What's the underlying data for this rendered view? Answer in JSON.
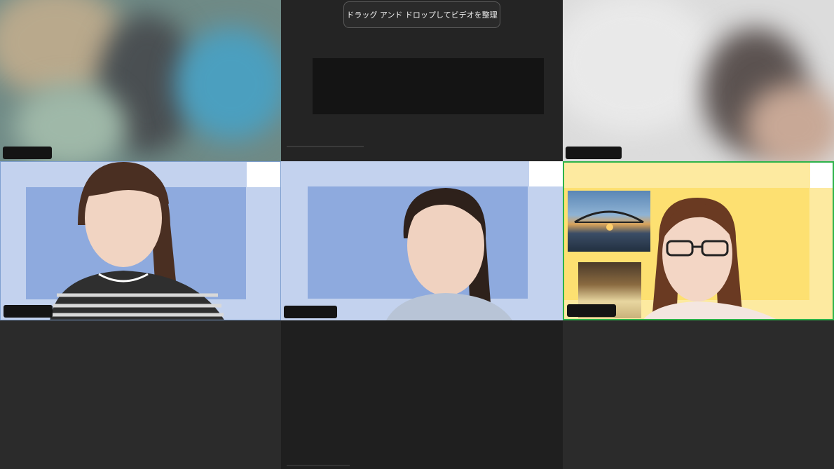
{
  "banner": {
    "text": "ドラッグ アンド ドロップしてビデオを整理"
  },
  "tiles": [
    {
      "id": "tile-1",
      "kind": "blurred-video"
    },
    {
      "id": "tile-2",
      "kind": "screen-share"
    },
    {
      "id": "tile-3",
      "kind": "blurred-video"
    },
    {
      "id": "tile-4",
      "kind": "participant-video",
      "background": "#c3d2ee"
    },
    {
      "id": "tile-5",
      "kind": "participant-video",
      "background": "#c3d2ee"
    },
    {
      "id": "tile-6",
      "kind": "participant-video",
      "background": "#fdeaa0",
      "active_speaker": true,
      "highlight_color": "#2db34a"
    },
    {
      "id": "tile-7",
      "kind": "empty"
    },
    {
      "id": "tile-8",
      "kind": "empty"
    },
    {
      "id": "tile-9",
      "kind": "empty"
    }
  ],
  "colors": {
    "active_speaker_border": "#2db34a",
    "name_bar": "#141414",
    "grid_background": "#1e1e1e"
  }
}
